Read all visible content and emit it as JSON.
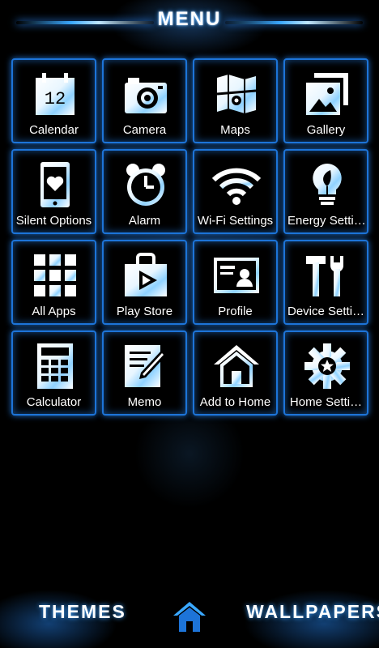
{
  "header": {
    "title": "MENU"
  },
  "tiles": [
    {
      "label": "Calendar",
      "icon": "calendar-icon",
      "day": "12"
    },
    {
      "label": "Camera",
      "icon": "camera-icon"
    },
    {
      "label": "Maps",
      "icon": "map-icon"
    },
    {
      "label": "Gallery",
      "icon": "gallery-icon"
    },
    {
      "label": "Silent Options",
      "icon": "phone-heart-icon"
    },
    {
      "label": "Alarm",
      "icon": "alarm-clock-icon"
    },
    {
      "label": "Wi-Fi Settings",
      "icon": "wifi-icon"
    },
    {
      "label": "Energy Setti…",
      "icon": "lightbulb-icon"
    },
    {
      "label": "All Apps",
      "icon": "grid-icon"
    },
    {
      "label": "Play Store",
      "icon": "store-bag-icon"
    },
    {
      "label": "Profile",
      "icon": "profile-card-icon"
    },
    {
      "label": "Device Setti…",
      "icon": "tools-icon"
    },
    {
      "label": "Calculator",
      "icon": "calculator-icon"
    },
    {
      "label": "Memo",
      "icon": "memo-icon"
    },
    {
      "label": "Add to Home",
      "icon": "house-icon"
    },
    {
      "label": "Home Setti…",
      "icon": "gear-icon"
    }
  ],
  "footer": {
    "themes_label": "THEMES",
    "wallpapers_label": "WALLPAPERS",
    "home_icon": "home-icon"
  },
  "colors": {
    "accent": "#1d74d8",
    "glow": "#3aa8ff",
    "background": "#000000",
    "text": "#ffffff"
  }
}
